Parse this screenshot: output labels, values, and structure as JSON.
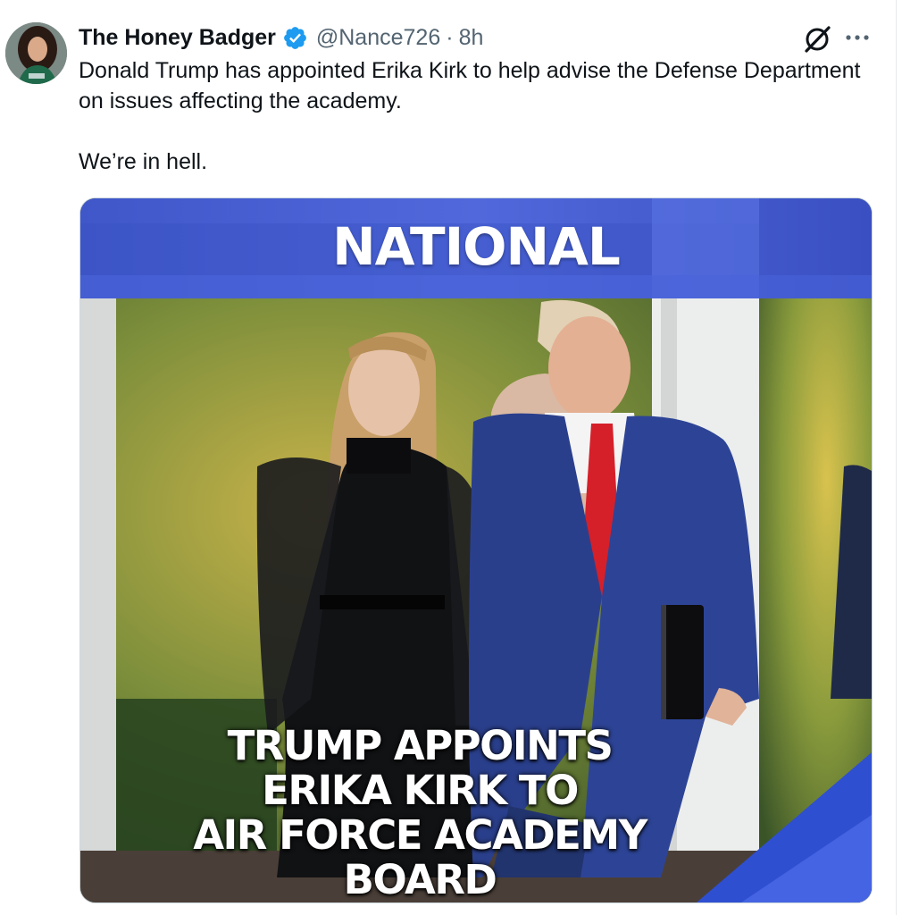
{
  "author": {
    "display_name": "The Honey Badger",
    "handle": "@Nance726",
    "separator": "·",
    "time": "8h",
    "verified": true,
    "avatar": "profile-photo"
  },
  "actions": {
    "grok_icon": "grok-icon",
    "more_icon": "more-icon"
  },
  "tweet": {
    "text_line_1": "Donald Trump has appointed Erika Kirk to help advise the Defense Department on issues affecting the academy.",
    "text_line_2": "We’re in hell."
  },
  "media": {
    "banner": "NATIONAL",
    "headline_lines": [
      "TRUMP APPOINTS",
      "ERIKA KIRK TO",
      "AIR FORCE ACADEMY",
      "BOARD"
    ]
  },
  "colors": {
    "verified_blue": "#1d9bf0",
    "banner_blue": "#4b63d8",
    "muted_text": "#536471"
  }
}
